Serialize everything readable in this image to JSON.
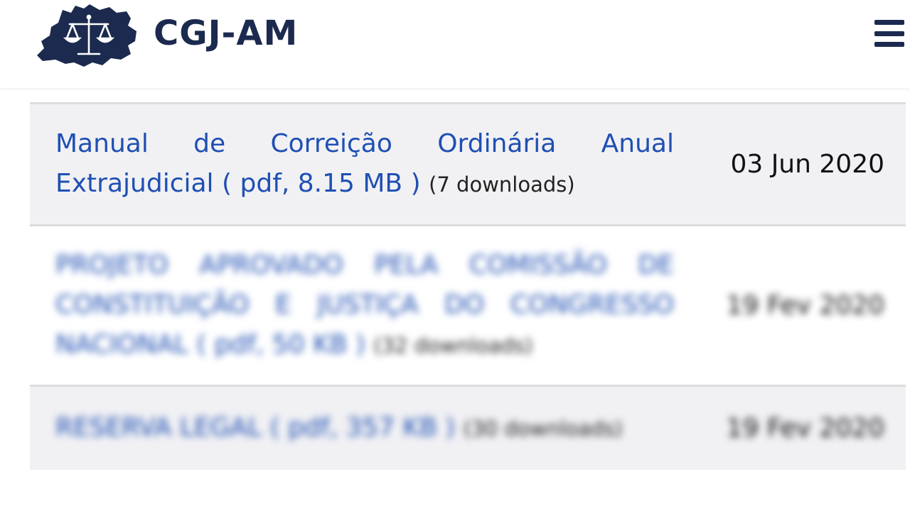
{
  "header": {
    "logo_text": "CGJ-AM",
    "logo_icon": "amazonas-map-with-scales-icon",
    "menu_icon": "hamburger-menu-icon"
  },
  "colors": {
    "brand_navy": "#1b2a4e",
    "link_blue": "#1f4fb3",
    "row_shade": "#f1f1f4",
    "divider": "#dcdcdf",
    "text_dark": "#111111"
  },
  "documents": [
    {
      "title": "Manual de Correição Ordinária Anual Extrajudicial",
      "file_info": "( pdf, 8.15 MB )",
      "downloads": "(7 downloads)",
      "date": "03 Jun 2020"
    },
    {
      "title": "PROJETO APROVADO PELA COMISSÃO DE CONSTITUIÇÃO E JUSTIÇA DO CONGRESSO NACIONAL",
      "file_info": "( pdf, 50 KB )",
      "downloads": "(32 downloads)",
      "date": "19 Fev 2020"
    },
    {
      "title": "RESERVA LEGAL",
      "file_info": "( pdf, 357 KB )",
      "downloads": "(30 downloads)",
      "date": "19 Fev 2020"
    }
  ]
}
